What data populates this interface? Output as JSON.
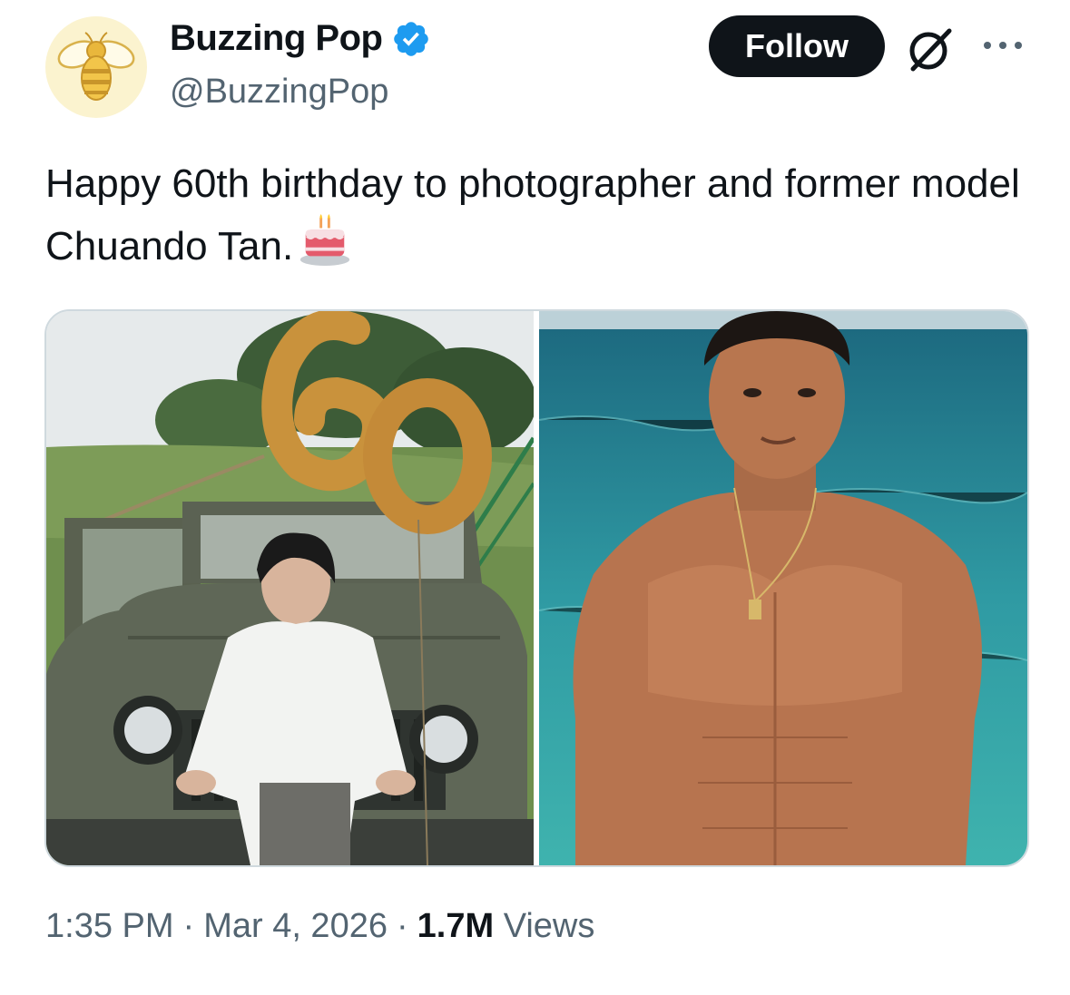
{
  "account": {
    "display_name": "Buzzing Pop",
    "handle": "@BuzzingPop",
    "avatar_icon": "bee-icon",
    "verified_icon": "verified-badge-icon",
    "verified_color": "#1d9bf0"
  },
  "actions": {
    "follow_label": "Follow",
    "grok_icon": "grok-icon",
    "more_icon": "more-icon"
  },
  "tweet": {
    "text": "Happy 60th birthday to photographer and former model Chuando Tan.",
    "emoji_icon": "birthday-cake-icon"
  },
  "media": {
    "photos": [
      {
        "icon": "photo-man-with-jeep-and-60-balloons"
      },
      {
        "icon": "photo-shirtless-man-in-sea"
      }
    ]
  },
  "meta": {
    "time": "1:35 PM",
    "separator": "·",
    "date": "Mar 4, 2026",
    "views_count": "1.7M",
    "views_label": "Views"
  },
  "colors": {
    "text": "#0f1419",
    "secondary": "#536471",
    "border": "#cfd9de",
    "button": "#0f1419"
  }
}
